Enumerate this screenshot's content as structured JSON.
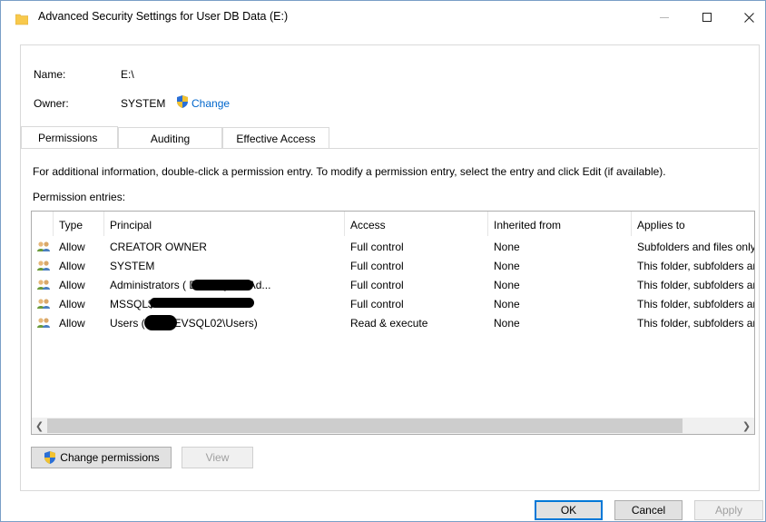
{
  "window": {
    "title": "Advanced Security Settings for User DB Data (E:)",
    "folder_color": "#f8c94c"
  },
  "header": {
    "name_label": "Name:",
    "name_value": "E:\\",
    "owner_label": "Owner:",
    "owner_value": "SYSTEM",
    "change_link": "Change"
  },
  "tabs": [
    {
      "label": "Permissions",
      "selected": true
    },
    {
      "label": "Auditing",
      "selected": false
    },
    {
      "label": "Effective Access",
      "selected": false
    }
  ],
  "info_text": "For additional information, double-click a permission entry. To modify a permission entry, select the entry and click Edit (if available).",
  "entries_label": "Permission entries:",
  "columns": [
    "Type",
    "Principal",
    "Access",
    "Inherited from",
    "Applies to"
  ],
  "rows": [
    {
      "type": "Allow",
      "principal": "CREATOR OWNER",
      "access": "Full control",
      "inherited": "None",
      "applies": "Subfolders and files only"
    },
    {
      "type": "Allow",
      "principal": "SYSTEM",
      "access": "Full control",
      "inherited": "None",
      "applies": "This folder, subfolders and files"
    },
    {
      "type": "Allow",
      "principal": "Administrators (              DEVSQL02\\Ad...",
      "access": "Full control",
      "inherited": "None",
      "applies": "This folder, subfolders and files"
    },
    {
      "type": "Allow",
      "principal": "MSSQL$",
      "access": "Full control",
      "inherited": "None",
      "applies": "This folder, subfolders and files"
    },
    {
      "type": "Allow",
      "principal": "Users (        WHDEVSQL02\\Users)",
      "access": "Read & execute",
      "inherited": "None",
      "applies": "This folder, subfolders and files"
    }
  ],
  "buttons": {
    "change_permissions": "Change permissions",
    "view": "View",
    "ok": "OK",
    "cancel": "Cancel",
    "apply": "Apply"
  },
  "icons": {
    "folder": "folder-icon",
    "shield": "uac-shield-icon",
    "user_group": "user-group-icon"
  },
  "colors": {
    "link": "#0066cc",
    "accent": "#0078d7"
  }
}
